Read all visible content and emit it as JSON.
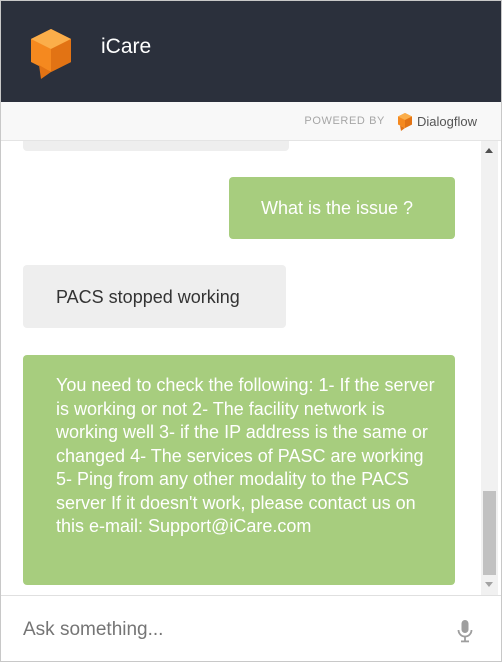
{
  "header": {
    "title": "iCare"
  },
  "powered": {
    "label": "POWERED BY",
    "brand": "Dialogflow"
  },
  "messages": [
    {
      "from": "user",
      "text": "What is the issue ?"
    },
    {
      "from": "bot",
      "text": "PACS stopped working"
    },
    {
      "from": "user",
      "text": "You need to check the following: 1- If the server is working or not 2- The facility network is working well 3- if the IP address is the same or changed 4- The services of PASC are working 5- Ping from any other modality to the PACS server If it doesn't work, please contact us on this e-mail: Support@iCare.com"
    }
  ],
  "input": {
    "placeholder": "Ask something...",
    "value": ""
  },
  "icons": {
    "logo": "orange-cube-chat-logo-icon",
    "brand_logo": "dialogflow-logo-icon",
    "mic": "microphone-icon",
    "scroll_up": "scroll-up-arrow-icon",
    "scroll_down": "scroll-down-arrow-icon"
  },
  "colors": {
    "header_bg": "#2b303c",
    "user_bubble": "#a7cd7e",
    "bot_bubble": "#eeeeee",
    "accent_orange": "#f5891f"
  }
}
